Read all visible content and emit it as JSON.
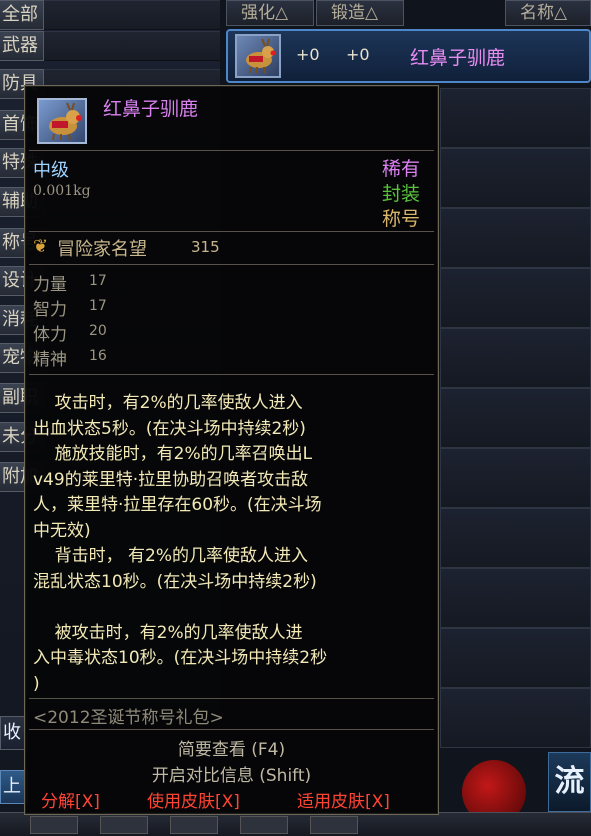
{
  "left_categories": [
    {
      "label": "全部"
    },
    {
      "label": "武器"
    },
    {
      "label": "防具"
    },
    {
      "label": "首饰"
    },
    {
      "label": "特殊"
    },
    {
      "label": "辅助"
    },
    {
      "label": "称号"
    },
    {
      "label": "设计"
    },
    {
      "label": "消耗"
    },
    {
      "label": "宠物"
    },
    {
      "label": "副职"
    },
    {
      "label": "未分"
    },
    {
      "label": "附加"
    }
  ],
  "left_bottom_tab": "收藏",
  "left_bottom_tab2": "上架",
  "columns": {
    "enhance": "强化△",
    "forge": "锻造△",
    "name": "名称△"
  },
  "selected_item": {
    "enhance": "+0",
    "forge": "+0",
    "name": "红鼻子驯鹿"
  },
  "tooltip": {
    "title": "红鼻子驯鹿",
    "grade": "中级",
    "weight": "0.001kg",
    "rarity": "稀有",
    "sealed": "封装",
    "type": "称号",
    "fame_label": "冒险家名望",
    "fame_value": "315",
    "stats": [
      {
        "name": "力量",
        "value": "17"
      },
      {
        "name": "智力",
        "value": "17"
      },
      {
        "name": "体力",
        "value": "20"
      },
      {
        "name": "精神",
        "value": "16"
      }
    ],
    "effect_text": "    攻击时，有2%的几率使敌人进入\n出血状态5秒。(在决斗场中持续2秒)\n    施放技能时，有2%的几率召唤出L\nv49的莱里特·拉里协助召唤者攻击敌\n人，莱里特·拉里存在60秒。(在决斗场\n中无效)\n    背击时， 有2%的几率使敌人进入\n混乱状态10秒。(在决斗场中持续2秒)\n\n    被攻击时，有2%的几率使敌人进\n入中毒状态10秒。(在决斗场中持续2秒\n)",
    "source": "<2012圣诞节称号礼包>",
    "hint_brief": "简要查看 (F4)",
    "hint_compare": "开启对比信息 (Shift)",
    "btn_disassemble": "分解[X]",
    "btn_use_skin": "使用皮肤[X]",
    "btn_apply_skin": "适用皮肤[X]"
  },
  "flow_label": "流",
  "colors": {
    "rare_purple": "#d880ee",
    "sealed_green": "#58c23b",
    "grade_blue": "#9fd2ff",
    "effect_yellow": "#f2e9b6",
    "action_red": "#ff4433"
  }
}
